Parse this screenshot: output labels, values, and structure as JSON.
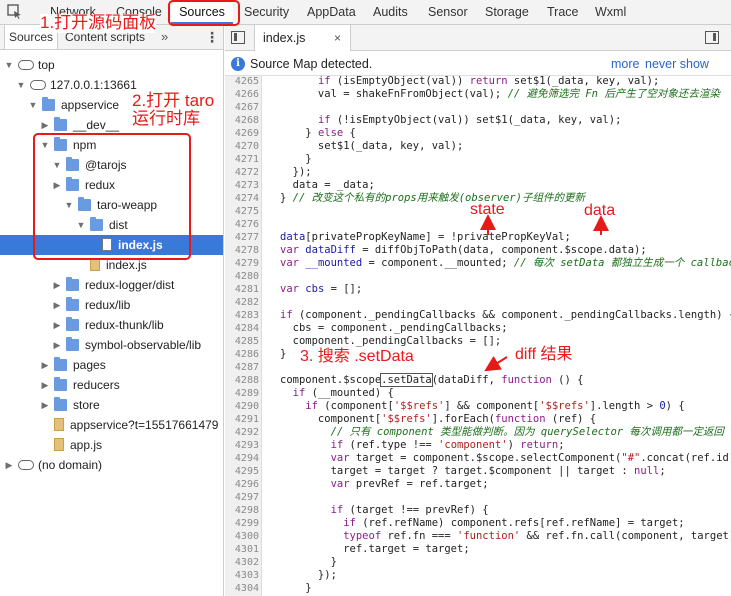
{
  "top_tabs": [
    "Network",
    "Console",
    "Sources",
    "Security",
    "AppData",
    "Audits",
    "Sensor",
    "Storage",
    "Trace",
    "Wxml"
  ],
  "nav": {
    "tabs": [
      "Sources",
      "Content scripts"
    ],
    "more": "»",
    "kebab": "⋮",
    "tree": [
      {
        "label": "top",
        "type": "cloud",
        "arrow": "down"
      },
      {
        "label": "127.0.0.1:13661",
        "type": "cloud",
        "arrow": "down"
      },
      {
        "label": "appservice",
        "type": "folder",
        "arrow": "down"
      },
      {
        "label": "__dev__",
        "type": "folder",
        "arrow": "right"
      },
      {
        "label": "npm",
        "type": "folder",
        "arrow": "down"
      },
      {
        "label": "@tarojs",
        "type": "folder",
        "arrow": "down"
      },
      {
        "label": "redux",
        "type": "folder",
        "arrow": "right"
      },
      {
        "label": "taro-weapp",
        "type": "folder",
        "arrow": "down"
      },
      {
        "label": "dist",
        "type": "folder",
        "arrow": "down"
      },
      {
        "label": "index.js",
        "type": "file-white",
        "arrow": "",
        "selected": true
      },
      {
        "label": "index.js",
        "type": "file",
        "arrow": ""
      },
      {
        "label": "redux-logger/dist",
        "type": "folder",
        "arrow": "right"
      },
      {
        "label": "redux/lib",
        "type": "folder",
        "arrow": "right"
      },
      {
        "label": "redux-thunk/lib",
        "type": "folder",
        "arrow": "right"
      },
      {
        "label": "symbol-observable/lib",
        "type": "folder",
        "arrow": "right"
      },
      {
        "label": "pages",
        "type": "folder",
        "arrow": "right"
      },
      {
        "label": "reducers",
        "type": "folder",
        "arrow": "right"
      },
      {
        "label": "store",
        "type": "folder",
        "arrow": "right"
      },
      {
        "label": "appservice?t=15517661479",
        "type": "file",
        "arrow": ""
      },
      {
        "label": "app.js",
        "type": "file",
        "arrow": ""
      },
      {
        "label": "(no domain)",
        "type": "cloud",
        "arrow": "right"
      }
    ]
  },
  "editor": {
    "file_tab": "index.js",
    "close": "×",
    "infobar": {
      "message": "Source Map detected.",
      "more": "more",
      "never": "never show"
    },
    "lines": [
      {
        "n": "4265",
        "html": "      <span class='kw'>if</span> (isEmptyObject(val)) <span class='kw'>return</span> set$1(_data, key, val);"
      },
      {
        "n": "4266",
        "html": "      val = shakeFnFromObject(val); <span class='cm'>// 避免筛选完 Fn 后产生了空对象还去渲染</span>"
      },
      {
        "n": "4267",
        "html": ""
      },
      {
        "n": "4268",
        "html": "      <span class='kw'>if</span> (!isEmptyObject(val)) set$1(_data, key, val);"
      },
      {
        "n": "4269",
        "html": "    } <span class='kw'>else</span> {"
      },
      {
        "n": "4270",
        "html": "      set$1(_data, key, val);"
      },
      {
        "n": "4271",
        "html": "    }"
      },
      {
        "n": "4272",
        "html": "  });"
      },
      {
        "n": "4273",
        "html": "  data = _data;"
      },
      {
        "n": "4274",
        "html": "} <span class='cm'>// 改变这个私有的props用来触发(observer)子组件的更新</span>"
      },
      {
        "n": "4275",
        "html": ""
      },
      {
        "n": "4276",
        "html": ""
      },
      {
        "n": "4277",
        "html": "<span class='vr'>data</span>[privatePropKeyName] = !privatePropKeyVal;"
      },
      {
        "n": "4278",
        "html": "<span class='kw'>var</span> <span class='vr'>dataDiff</span> = diffObjToPath(data, component.$scope.data);"
      },
      {
        "n": "4279",
        "html": "<span class='kw'>var</span> <span class='vr'>__mounted</span> = component.__mounted; <span class='cm'>// 每次 setData 都独立生成一个 callbacks 数组</span>"
      },
      {
        "n": "4280",
        "html": ""
      },
      {
        "n": "4281",
        "html": "<span class='kw'>var</span> <span class='vr'>cbs</span> = [];"
      },
      {
        "n": "4282",
        "html": ""
      },
      {
        "n": "4283",
        "html": "<span class='kw'>if</span> (component._pendingCallbacks &amp;&amp; component._pendingCallbacks.length) {"
      },
      {
        "n": "4284",
        "html": "  cbs = component._pendingCallbacks;"
      },
      {
        "n": "4285",
        "html": "  component._pendingCallbacks = [];"
      },
      {
        "n": "4286",
        "html": "}"
      },
      {
        "n": "4287",
        "html": ""
      },
      {
        "n": "4288",
        "html": "component.$scope<span class='hlw'>.setData</span>(dataDiff, <span class='kw'>function</span> () {"
      },
      {
        "n": "4289",
        "html": "  <span class='kw'>if</span> (__mounted) {"
      },
      {
        "n": "4290",
        "html": "    <span class='kw'>if</span> (component[<span class='st'>'$$refs'</span>] &amp;&amp; component[<span class='st'>'$$refs'</span>].length &gt; <span class='nm'>0</span>) {"
      },
      {
        "n": "4291",
        "html": "      component[<span class='st'>'$$refs'</span>].forEach(<span class='kw'>function</span> (ref) {"
      },
      {
        "n": "4292",
        "html": "        <span class='cm'>// 只有 component 类型能做判断。因为 querySelector 每次调用都一定返回</span>"
      },
      {
        "n": "4293",
        "html": "        <span class='kw'>if</span> (ref.type !== <span class='st'>'component'</span>) <span class='kw'>return</span>;"
      },
      {
        "n": "4294",
        "html": "        <span class='kw'>var</span> target = component.$scope.selectComponent(<span class='st'>\"#\"</span>.concat(ref.id));"
      },
      {
        "n": "4295",
        "html": "        target = target ? target.$component || target : <span class='kw'>null</span>;"
      },
      {
        "n": "4296",
        "html": "        <span class='kw'>var</span> prevRef = ref.target;"
      },
      {
        "n": "4297",
        "html": ""
      },
      {
        "n": "4298",
        "html": "        <span class='kw'>if</span> (target !== prevRef) {"
      },
      {
        "n": "4299",
        "html": "          <span class='kw'>if</span> (ref.refName) component.refs[ref.refName] = target;"
      },
      {
        "n": "4300",
        "html": "          <span class='kw'>typeof</span> ref.fn === <span class='st'>'function'</span> &amp;&amp; ref.fn.call(component, target);"
      },
      {
        "n": "4301",
        "html": "          ref.target = target;"
      },
      {
        "n": "4302",
        "html": "        }"
      },
      {
        "n": "4303",
        "html": "      });"
      },
      {
        "n": "4304",
        "html": "    }"
      }
    ]
  },
  "annotations": {
    "a1": "1.打开源码面板",
    "a2_line1": "2.打开 taro",
    "a2_line2": "运行时库",
    "state": "state",
    "data": "data",
    "a3": "3. 搜索 .setData",
    "diff": "diff 结果"
  },
  "colors": {
    "annotation": "#e81919",
    "selection": "#3879d9",
    "link": "#2a66c8"
  }
}
